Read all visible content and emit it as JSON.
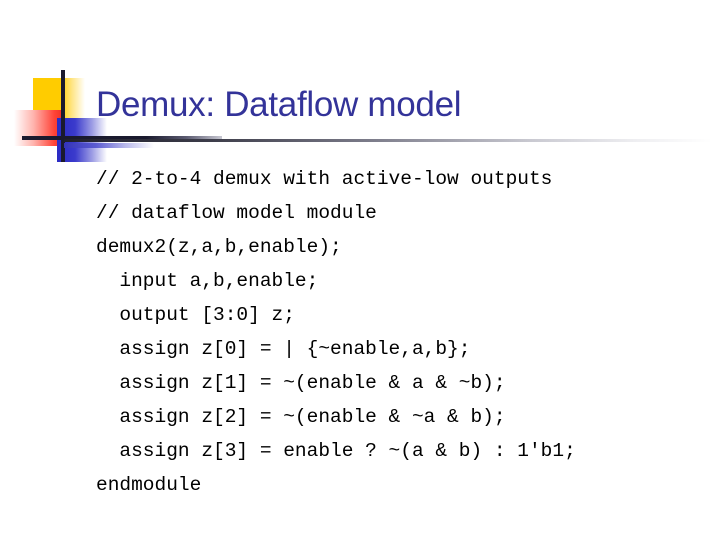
{
  "slide": {
    "title": "Demux: Dataflow model",
    "title_color": "#333399",
    "background_color": "#ffffff",
    "decoration": {
      "yellow_color": "#FFCC00",
      "red_color": "#FF4438",
      "blue_color": "#2B2BC4",
      "crosshair_color": "#1a1a2e"
    },
    "code_lines": [
      "// 2-to-4 demux with active-low outputs",
      "// dataflow model module",
      "demux2(z,a,b,enable);",
      "  input a,b,enable;",
      "  output [3:0] z;",
      "  assign z[0] = | {~enable,a,b};",
      "  assign z[1] = ~(enable & a & ~b);",
      "  assign z[2] = ~(enable & ~a & b);",
      "  assign z[3] = enable ? ~(a & b) : 1'b1;",
      "endmodule"
    ]
  }
}
